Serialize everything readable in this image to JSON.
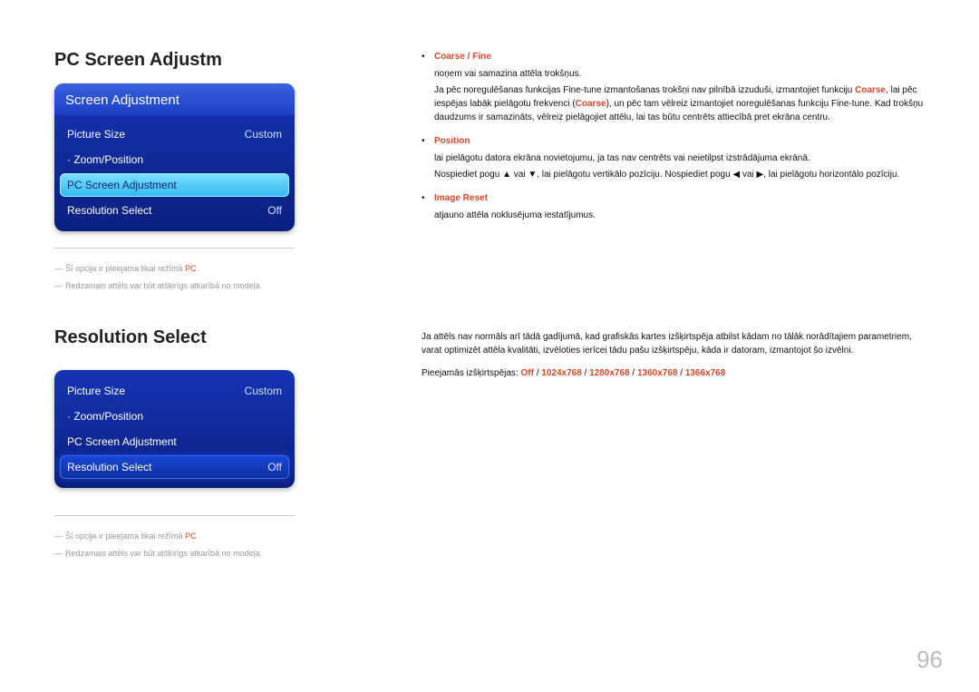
{
  "page_number": "96",
  "section1": {
    "title": "PC Screen Adjustm",
    "menu_header": "Screen Adjustment",
    "rows": {
      "picture_size_label": "Picture Size",
      "picture_size_value": "Custom",
      "zoom_label": "·  Zoom/Position",
      "zoom_value": "",
      "pc_adj_label": "PC Screen Adjustment",
      "pc_adj_value": "",
      "res_label": "Resolution Select",
      "res_value": "Off"
    },
    "footnote1_pre": "Šī opcija ir pieejama tikai režīmā ",
    "footnote1_hl": "PC",
    "footnote1_post": ".",
    "footnote2": "Redzamais attēls var būt atšķirīgs atkarībā no modeļa.",
    "bullets": {
      "b1_title": "Coarse / Fine",
      "b1_l1": "noņem vai samazina attēla trokšņus.",
      "b1_l2_pre": "Ja pēc noregulēšanas funkcijas Fine-tune izmantošanas trokšņi nav pilnībā izzuduši, izmantojiet funkciju ",
      "b1_l2_hl1": "Coarse",
      "b1_l2_mid": ", lai pēc iespējas labāk pielāgotu frekvenci (",
      "b1_l2_hl2": "Coarse",
      "b1_l2_post": "), un pēc tam vēlreiz izmantojiet noregulēšanas funkciju Fine-tune. Kad trokšņu daudzums ir samazināts, vēlreiz pielāgojiet attēlu, lai tas būtu centrēts attiecībā pret ekrāna centru.",
      "b2_title": "Position",
      "b2_l1": "lai pielāgotu datora ekrāna novietojumu, ja tas nav centrēts vai neietilpst izstrādājuma ekrānā.",
      "b2_l2_pre": "Nospiediet pogu ",
      "b2_l2_or1": " vai ",
      "b2_l2_mid": ", lai pielāgotu vertikālo pozīciju. Nospiediet pogu ",
      "b2_l2_or2": " vai ",
      "b2_l2_post": ", lai pielāgotu horizontālo pozīciju.",
      "b3_title": "Image Reset",
      "b3_l1": "atjauno attēla noklusējuma iestatījumus."
    }
  },
  "section2": {
    "title": "Resolution Select",
    "rows": {
      "picture_size_label": "Picture Size",
      "picture_size_value": "Custom",
      "zoom_label": "·  Zoom/Position",
      "zoom_value": "",
      "pc_adj_label": "PC Screen Adjustment",
      "pc_adj_value": "",
      "res_label": "Resolution Select",
      "res_value": "Off"
    },
    "footnote1_pre": "Šī opcija ir pieejama tikai režīmā ",
    "footnote1_hl": "PC",
    "footnote1_post": ".",
    "footnote2": "Redzamais attēls var būt atšķirīgs atkarībā no modeļa.",
    "desc": "Ja attēls nav normāls arī tādā gadījumā, kad grafiskās kartes izšķirtspēja atbilst kādam no tālāk norādītajiem parametriem, varat optimizēt attēla kvalitāti, izvēloties ierīcei tādu pašu izšķirtspēju, kāda ir datoram, izmantojot šo izvēlni.",
    "res_line_pre": "Pieejamās izšķirtspējas: ",
    "res_off": "Off",
    "res_sep": " / ",
    "res_1": "1024x768",
    "res_2": "1280x768",
    "res_3": "1360x768",
    "res_4": "1366x768"
  }
}
